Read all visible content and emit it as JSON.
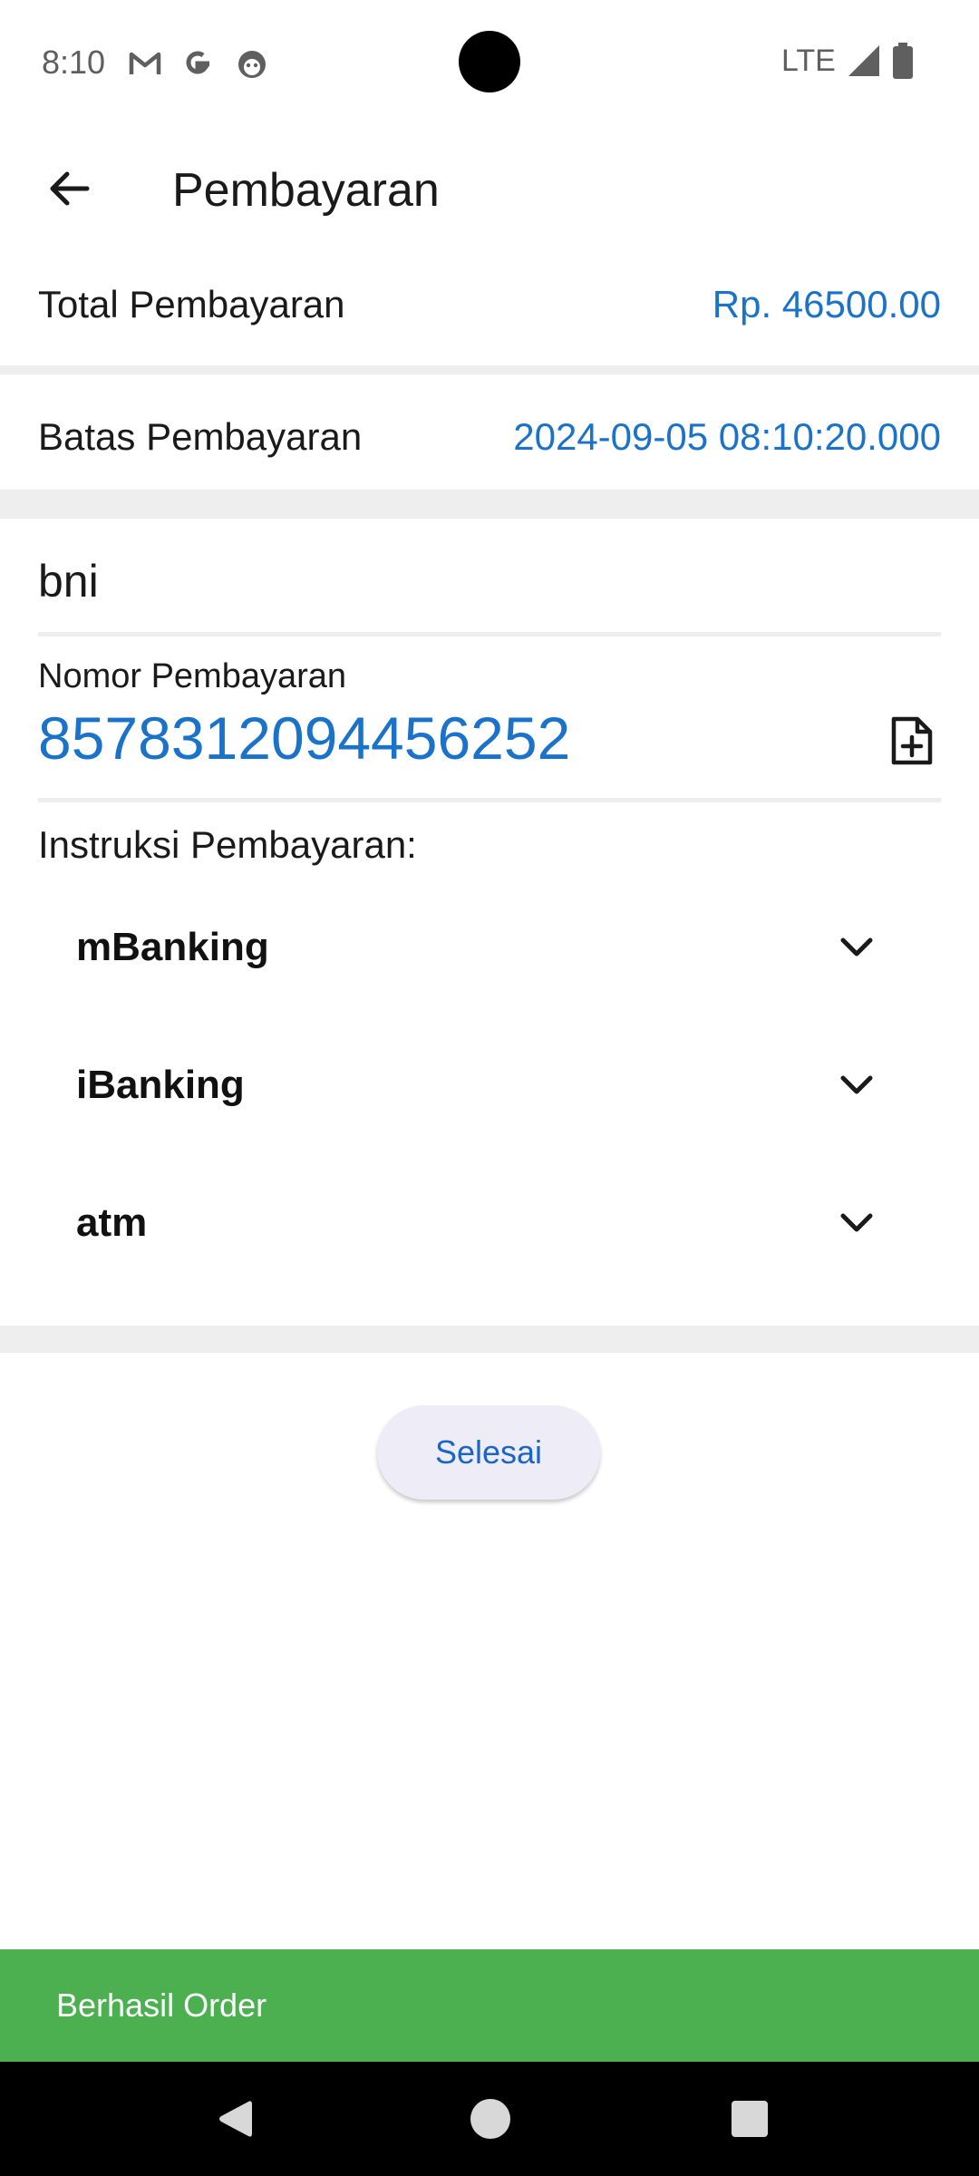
{
  "status_bar": {
    "time": "8:10",
    "network": "LTE",
    "icons": [
      "gmail-icon",
      "google-icon",
      "app-icon",
      "signal-icon",
      "battery-icon"
    ]
  },
  "app_bar": {
    "title": "Pembayaran",
    "back_icon": "arrow-left-icon"
  },
  "summary": {
    "total_label": "Total Pembayaran",
    "total_value": "Rp. 46500.00",
    "deadline_label": "Batas Pembayaran",
    "deadline_value": "2024-09-05 08:10:20.000"
  },
  "payment": {
    "bank": "bni",
    "number_label": "Nomor Pembayaran",
    "number_value": "8578312094456252",
    "copy_icon": "file-plus-icon",
    "instructions_title": "Instruksi Pembayaran:",
    "instructions": [
      {
        "label": "mBanking"
      },
      {
        "label": "iBanking"
      },
      {
        "label": "atm"
      }
    ]
  },
  "actions": {
    "done_label": "Selesai"
  },
  "snackbar": {
    "message": "Berhasil Order"
  },
  "colors": {
    "accent": "#1a73c8",
    "snackbar": "#4caf50",
    "divider": "#eeeeee"
  }
}
